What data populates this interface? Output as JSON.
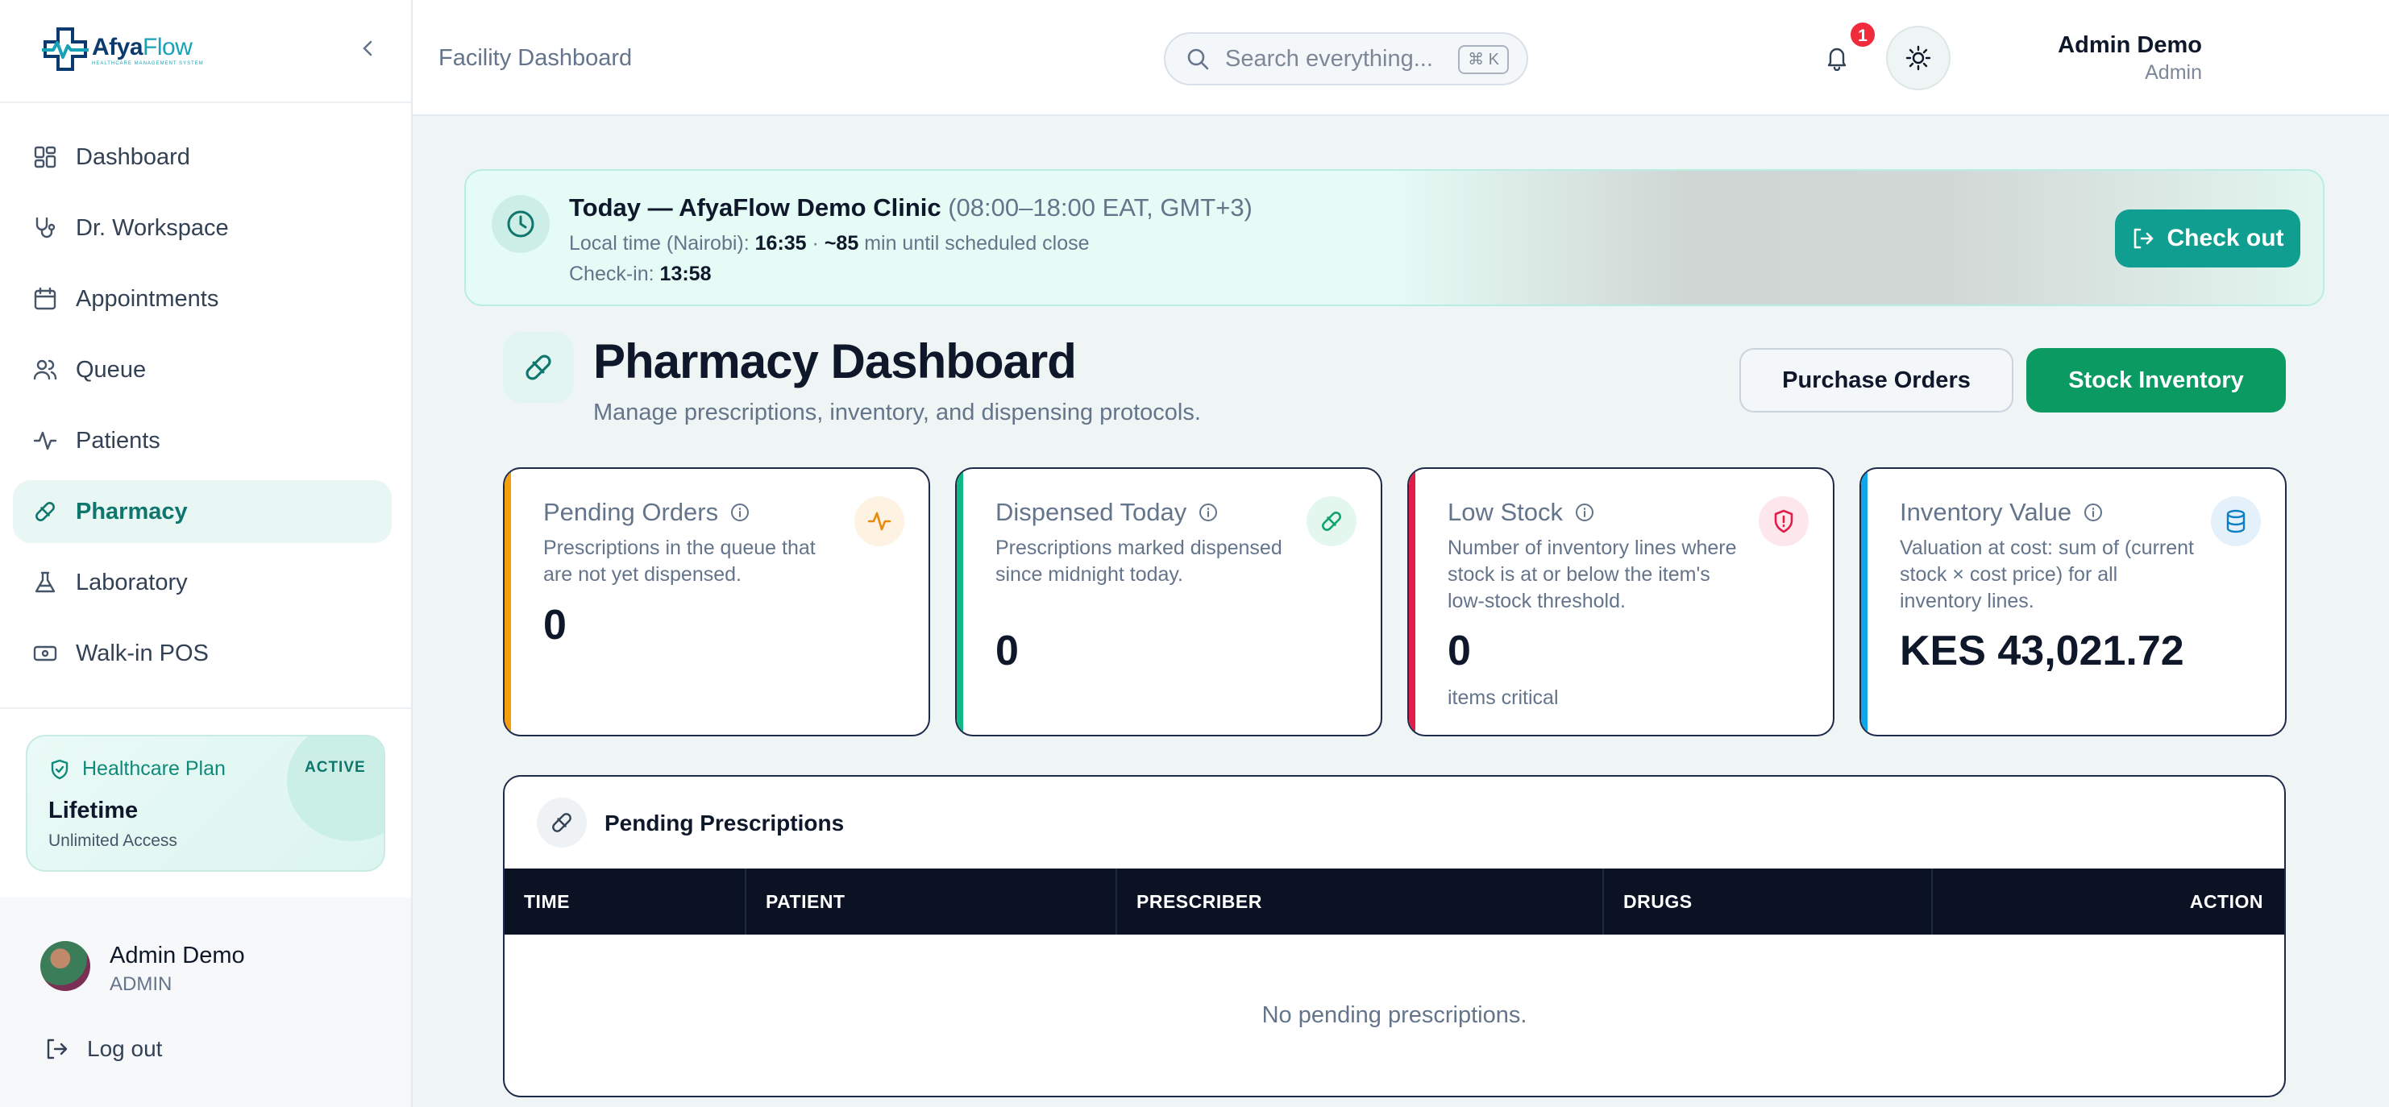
{
  "brand": {
    "name_a": "Afya",
    "name_b": "Flow",
    "tagline": "HEALTHCARE MANAGEMENT SYSTEM"
  },
  "sidebar": {
    "items": [
      {
        "label": "Dashboard",
        "icon": "dashboard-icon"
      },
      {
        "label": "Dr. Workspace",
        "icon": "stethoscope-icon"
      },
      {
        "label": "Appointments",
        "icon": "calendar-icon"
      },
      {
        "label": "Queue",
        "icon": "users-icon"
      },
      {
        "label": "Patients",
        "icon": "activity-icon"
      },
      {
        "label": "Pharmacy",
        "icon": "pill-icon",
        "active": true
      },
      {
        "label": "Laboratory",
        "icon": "flask-icon"
      },
      {
        "label": "Walk-in POS",
        "icon": "cash-icon"
      }
    ],
    "plan": {
      "title": "Healthcare Plan",
      "badge": "ACTIVE",
      "name": "Lifetime",
      "sub": "Unlimited Access"
    },
    "user": {
      "name": "Admin Demo",
      "role": "ADMIN"
    },
    "logout": "Log out"
  },
  "topbar": {
    "breadcrumb": "Facility Dashboard",
    "search_placeholder": "Search everything...",
    "shortcut": "⌘ K",
    "user_name": "Admin Demo",
    "user_role": "Admin",
    "notifications": "1"
  },
  "banner": {
    "title": "Today — AfyaFlow Demo Clinic",
    "hours": "(08:00–18:00 EAT, GMT+3)",
    "local_label": "Local time (Nairobi):",
    "local_time": "16:35",
    "sep": "·",
    "remaining": "~85",
    "remaining_suffix": "min until scheduled close",
    "checkin_label": "Check-in:",
    "checkin_time": "13:58",
    "checkout_label": "Check out"
  },
  "page": {
    "title": "Pharmacy Dashboard",
    "subtitle": "Manage prescriptions, inventory, and dispensing protocols.",
    "btn_purchase": "Purchase Orders",
    "btn_stock": "Stock Inventory"
  },
  "stats": [
    {
      "title": "Pending Orders",
      "desc": "Prescriptions in the queue that are not yet dispensed.",
      "value": "0",
      "foot": "",
      "accent": "#f59e0b"
    },
    {
      "title": "Dispensed Today",
      "desc": "Prescriptions marked dispensed since midnight today.",
      "value": "0",
      "foot": "",
      "accent": "#10b981"
    },
    {
      "title": "Low Stock",
      "desc": "Number of inventory lines where stock is at or below the item's low-stock threshold.",
      "value": "0",
      "foot": "items critical",
      "accent": "#e11d48"
    },
    {
      "title": "Inventory Value",
      "desc": "Valuation at cost: sum of (current stock × cost price) for all inventory lines.",
      "value": "KES 43,021.72",
      "foot": "",
      "accent": "#0ea5e9"
    }
  ],
  "table": {
    "title": "Pending Prescriptions",
    "columns": [
      "TIME",
      "PATIENT",
      "PRESCRIBER",
      "DRUGS",
      "ACTION"
    ],
    "empty": "No pending prescriptions."
  },
  "colors": {
    "brand": "#0f9e8f",
    "stock_button": "#0a9a62",
    "table_header": "#0b1224"
  }
}
